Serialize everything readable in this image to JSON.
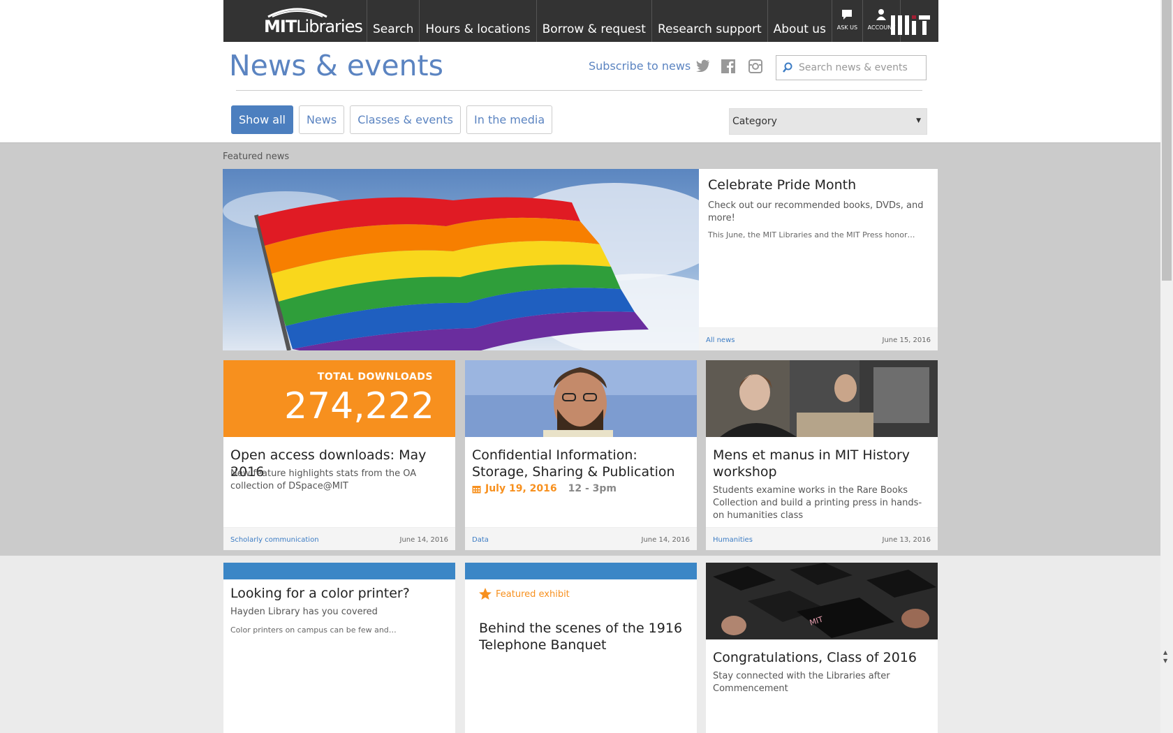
{
  "nav": {
    "logo_bold": "MIT",
    "logo_light": "Libraries",
    "items": [
      {
        "label": "Search"
      },
      {
        "label": "Hours & locations"
      },
      {
        "label": "Borrow & request"
      },
      {
        "label": "Research support"
      },
      {
        "label": "About us"
      }
    ],
    "ask_us": "ASK US",
    "account": "ACCOUNT",
    "mit_logo": "MIT"
  },
  "header": {
    "title": "News & events",
    "subscribe": "Subscribe to news",
    "search_placeholder": "Search news & events"
  },
  "filters": [
    {
      "label": "Show all",
      "active": true
    },
    {
      "label": "News",
      "active": false
    },
    {
      "label": "Classes & events",
      "active": false
    },
    {
      "label": "In the media",
      "active": false
    }
  ],
  "category_select": "Category",
  "featured_label": "Featured news",
  "hero": {
    "title": "Celebrate Pride Month",
    "subtitle": "Check out our recommended books, DVDs, and more!",
    "body": "This June, the MIT Libraries and the MIT Press honor…",
    "category": "All news",
    "date": "June 15, 2016"
  },
  "cards": [
    {
      "downloads_label": "TOTAL DOWNLOADS",
      "downloads_value": "274,222",
      "title": "Open access downloads: May 2016",
      "subtitle": "New feature highlights stats from the OA collection of DSpace@MIT",
      "category": "Scholarly communication",
      "date": "June 14, 2016"
    },
    {
      "title": "Confidential Information: Storage, Sharing & Publication",
      "event_date": "July 19, 2016",
      "event_time": "12 - 3pm",
      "category": "Data",
      "date": "June 14, 2016"
    },
    {
      "title": "Mens et manus in MIT History workshop",
      "subtitle": "Students examine works in the Rare Books Collection and build a printing press in hands-on humanities class",
      "category": "Humanities",
      "date": "June 13, 2016"
    },
    {
      "title": "Looking for a color printer?",
      "subtitle": "Hayden Library has you covered",
      "body": "Color printers on campus can be few and…"
    },
    {
      "exhibit_label": "Featured exhibit",
      "title": "Behind the scenes of the 1916 Telephone Banquet"
    },
    {
      "title": "Congratulations, Class of 2016",
      "subtitle": "Stay connected with the Libraries after Commencement"
    }
  ],
  "colors": {
    "nav_bg": "#333333",
    "accent_blue": "#5b84c1",
    "active_filter": "#4c7fbf",
    "orange": "#f7901e",
    "link_blue": "#3c7cc4",
    "bar_blue": "#3b86c6"
  },
  "icons": [
    "chat-bubble-icon",
    "account-icon",
    "twitter-icon",
    "facebook-icon",
    "instagram-icon",
    "search-icon",
    "calendar-icon",
    "star-icon",
    "dropdown-arrow-icon"
  ]
}
